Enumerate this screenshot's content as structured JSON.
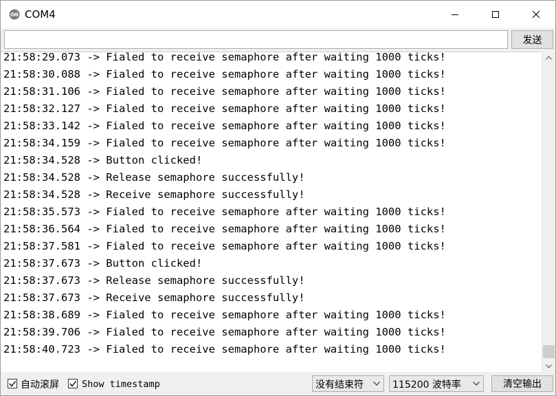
{
  "window": {
    "title": "COM4",
    "icon": "arduino-logo-icon",
    "controls": [
      "minimize-icon",
      "maximize-icon",
      "close-icon"
    ]
  },
  "send_row": {
    "input_value": "",
    "send_label": "发送"
  },
  "output": {
    "lines": [
      "21:58:29.073 -> Fialed to receive semaphore after waiting 1000 ticks!",
      "21:58:30.088 -> Fialed to receive semaphore after waiting 1000 ticks!",
      "21:58:31.106 -> Fialed to receive semaphore after waiting 1000 ticks!",
      "21:58:32.127 -> Fialed to receive semaphore after waiting 1000 ticks!",
      "21:58:33.142 -> Fialed to receive semaphore after waiting 1000 ticks!",
      "21:58:34.159 -> Fialed to receive semaphore after waiting 1000 ticks!",
      "21:58:34.528 -> Button clicked!",
      "21:58:34.528 -> Release semaphore successfully!",
      "21:58:34.528 -> Receive semaphore successfully!",
      "21:58:35.573 -> Fialed to receive semaphore after waiting 1000 ticks!",
      "21:58:36.564 -> Fialed to receive semaphore after waiting 1000 ticks!",
      "21:58:37.581 -> Fialed to receive semaphore after waiting 1000 ticks!",
      "21:58:37.673 -> Button clicked!",
      "21:58:37.673 -> Release semaphore successfully!",
      "21:58:37.673 -> Receive semaphore successfully!",
      "21:58:38.689 -> Fialed to receive semaphore after waiting 1000 ticks!",
      "21:58:39.706 -> Fialed to receive semaphore after waiting 1000 ticks!",
      "21:58:40.723 -> Fialed to receive semaphore after waiting 1000 ticks!"
    ]
  },
  "statusbar": {
    "autoscroll_label": "自动滚屏",
    "autoscroll_checked": true,
    "timestamp_label": "Show timestamp",
    "timestamp_checked": true,
    "line_ending": "没有结束符",
    "baud_rate": "115200 波特率",
    "clear_label": "清空输出"
  },
  "colors": {
    "arduino_teal": "#00979c",
    "window_bg": "#f0f0f0",
    "output_bg": "#ffffff"
  }
}
